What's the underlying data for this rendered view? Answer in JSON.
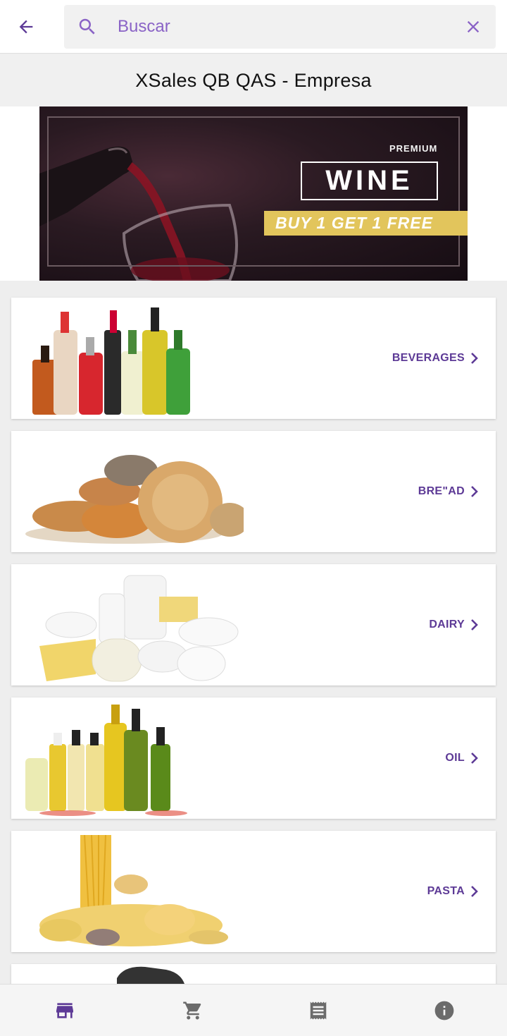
{
  "search": {
    "placeholder": "Buscar"
  },
  "company": {
    "title": "XSales QB QAS - Empresa"
  },
  "banner": {
    "premium": "PREMIUM",
    "wine": "WINE",
    "promo": "BUY 1 GET 1 FREE"
  },
  "categories": [
    {
      "label": "BEVERAGES"
    },
    {
      "label": "BRE\"AD"
    },
    {
      "label": "DAIRY"
    },
    {
      "label": "OIL"
    },
    {
      "label": "PASTA"
    }
  ],
  "nav": {
    "items": [
      "store-icon",
      "cart-icon",
      "receipt-icon",
      "info-icon"
    ],
    "active_color": "#5d3a96",
    "inactive_color": "#6b6b6b"
  },
  "colors": {
    "accent": "#5d3a96",
    "search_text": "#8a63c6"
  }
}
